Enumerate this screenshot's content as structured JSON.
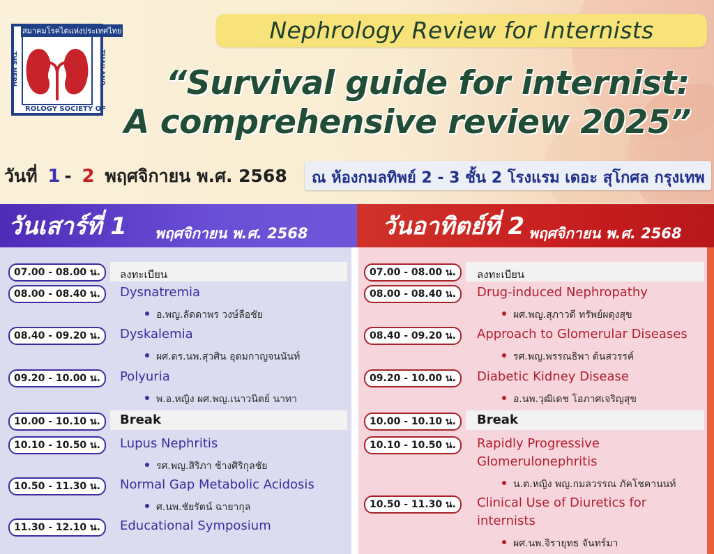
{
  "logo": {
    "ring_text_top": "สมาคมโรคไตแห่งประเทศไทย",
    "ring_text_left": "THE NEPH",
    "ring_text_bottom": "ROLOGY SOCIETY OF",
    "ring_text_right": "THAILAND",
    "ring_color": "#1f3f86",
    "kidney_color": "#c8222a"
  },
  "header": {
    "series_title": "Nephrology Review for Internists",
    "title_line1": "“Survival guide for internist:",
    "title_line2": "A comprehensive review 2025”",
    "date_prefix": "วันที่",
    "date_day1": "1",
    "date_sep": "-",
    "date_day2": "2",
    "date_suffix": "พฤศจิกายน พ.ศ. 2568",
    "venue": "ณ ห้องกมลทิพย์ 2 - 3 ชั้น 2 โรงแรม เดอะ สุโกศล กรุงเทพ"
  },
  "day1": {
    "name": "วันเสาร์ที่ 1",
    "month": "พฤศจิกายน พ.ศ. 2568",
    "accent": "#3b2c9e",
    "sessions": [
      {
        "time": "07.00 - 08.00 น.",
        "topic": "ลงทะเบียน"
      },
      {
        "time": "08.00 - 08.40 น.",
        "topic": "Dysnatremia",
        "speaker": "อ.พญ.ลัดดาพร วงษ์ลือชัย"
      },
      {
        "time": "08.40 - 09.20 น.",
        "topic": "Dyskalemia",
        "speaker": "ผศ.ดร.นพ.สุวศิน อุดมกาญจนนันท์"
      },
      {
        "time": "09.20 - 10.00 น.",
        "topic": "Polyuria",
        "speaker": "พ.อ.หญิง ผศ.พญ.เนาวนิตย์ นาทา"
      },
      {
        "time": "10.00 - 10.10 น.",
        "topic": "Break"
      },
      {
        "time": "10.10 - 10.50 น.",
        "topic": "Lupus Nephritis",
        "speaker": "รศ.พญ.สิริภา ช้างศิริกุลชัย"
      },
      {
        "time": "10.50 - 11.30 น.",
        "topic": "Normal Gap Metabolic Acidosis",
        "speaker": "ศ.นพ.ชัยรัตน์ ฉายากุล"
      },
      {
        "time": "11.30 - 12.10 น.",
        "topic": "Educational Symposium"
      }
    ]
  },
  "day2": {
    "name": "วันอาทิตย์ที่ 2",
    "month": "พฤศจิกายน พ.ศ. 2568",
    "accent": "#b21e2f",
    "sessions": [
      {
        "time": "07.00 - 08.00 น.",
        "topic": "ลงทะเบียน"
      },
      {
        "time": "08.00 - 08.40 น.",
        "topic": "Drug-induced Nephropathy",
        "speaker": "ผศ.พญ.สุภาวดี ทรัพย์ผดุงสุข"
      },
      {
        "time": "08.40 - 09.20 น.",
        "topic": "Approach to Glomerular Diseases",
        "speaker": "รศ.พญ.พรรณธิพา ต้นสวรรค์"
      },
      {
        "time": "09.20 - 10.00 น.",
        "topic": "Diabetic Kidney Disease",
        "speaker": "อ.นพ.วุฒิเดช โอภาศเจริญสุข"
      },
      {
        "time": "10.00 - 10.10 น.",
        "topic": "Break"
      },
      {
        "time": "10.10 - 10.50 น.",
        "topic_line1": "Rapidly Progressive",
        "topic_line2": "Glomerulonephritis",
        "speaker": "น.ต.หญิง พญ.กมลวรรณ ภัคโชคานนท์"
      },
      {
        "time": "10.50 - 11.30 น.",
        "topic_line1": "Clinical Use of Diuretics for",
        "topic_line2": "internists",
        "speaker": "ผศ.นพ.จิรายุทธ จันทร์มา"
      }
    ]
  }
}
